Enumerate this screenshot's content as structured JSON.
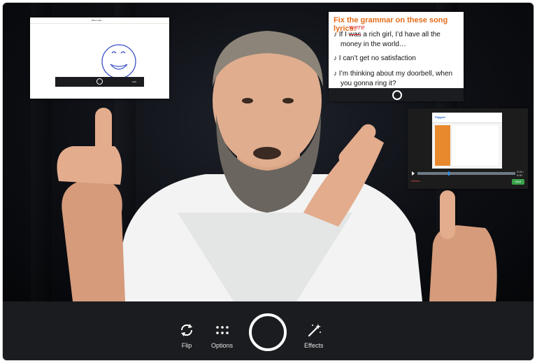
{
  "controls": {
    "flip_label": "Flip",
    "options_label": "Options",
    "effects_label": "Effects"
  },
  "thumb_whiteboard": {
    "title": "Blank slate",
    "minibar_time": "0:00"
  },
  "thumb_lyrics": {
    "heading": "Fix the grammar on these song lyrics:",
    "line1_prefix": "♪ If I ",
    "line1_struck": "was",
    "line1_correction": "were",
    "line1_rest": " a rich girl, I’d have all the",
    "line1_cont": "money in the world…",
    "line2": "♪ I can’t get no satisfaction",
    "line3": "♪ I’m thinking about my doorbell, when",
    "line3_cont": "you gonna ring it?"
  },
  "thumb_browser": {
    "logo": "Flipgrid",
    "time": "0:00 / 0:00",
    "next_label": "Next",
    "cancel_label": "Retake"
  },
  "colors": {
    "control_bar": "#1b1c1f",
    "accent_orange": "#e26c1a",
    "correction_red": "#dd2222",
    "next_green": "#3aa34a"
  }
}
